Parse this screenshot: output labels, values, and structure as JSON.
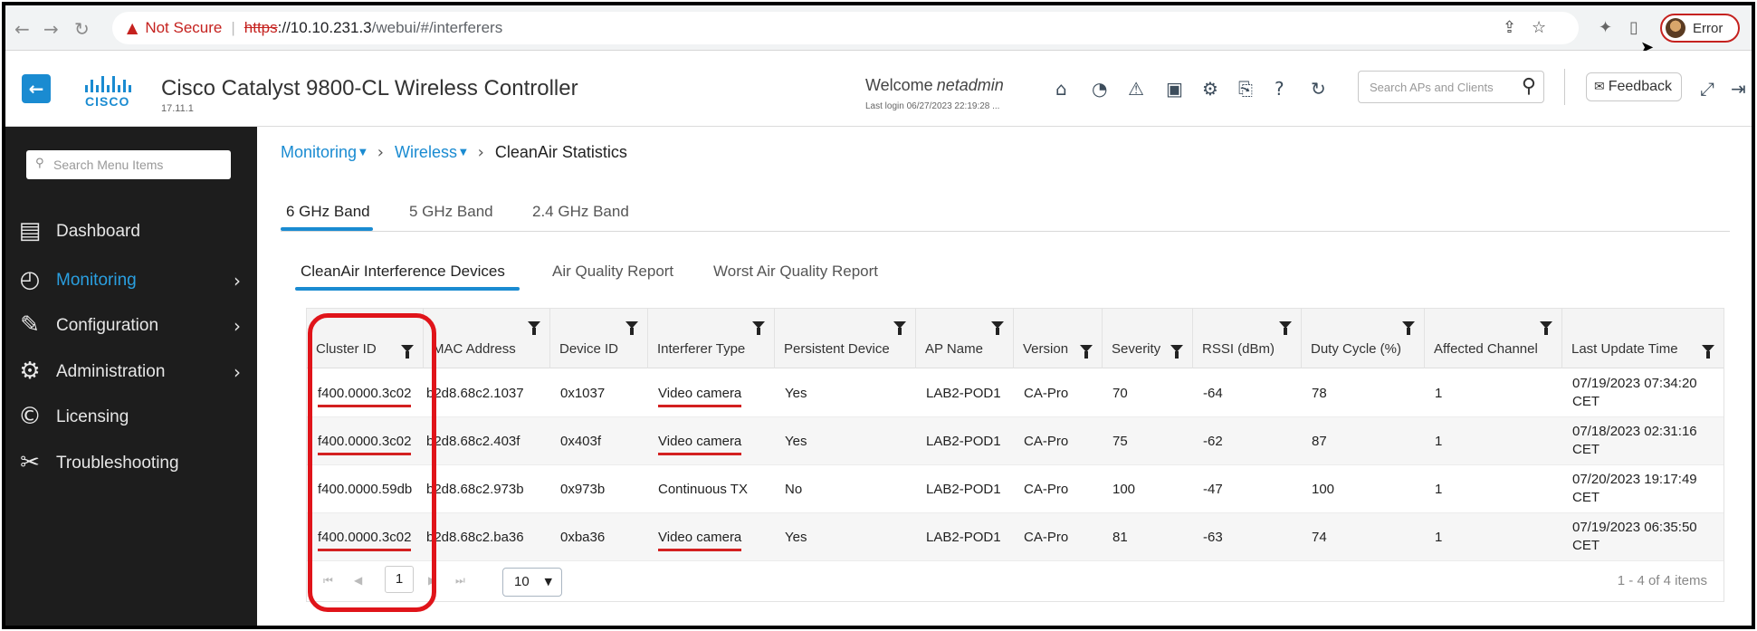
{
  "browser": {
    "security_label": "Not Secure",
    "url_scheme": "https",
    "url_host": "://10.10.231.3",
    "url_path": "/webui/#/interferers",
    "profile_label": "Error"
  },
  "header": {
    "logo_text": "CISCO",
    "title": "Cisco Catalyst 9800-CL Wireless Controller",
    "version": "17.11.1",
    "welcome_prefix": "Welcome",
    "username": "netadmin",
    "last_login": "Last login 06/27/2023 22:19:28 ...",
    "search_placeholder": "Search APs and Clients",
    "feedback_label": "Feedback",
    "icons": [
      "home-icon",
      "wireless-icon",
      "alert-icon",
      "save-icon",
      "gear-icon",
      "config-icon",
      "help-icon",
      "refresh-icon"
    ]
  },
  "sidebar": {
    "search_placeholder": "Search Menu Items",
    "items": [
      {
        "label": "Dashboard",
        "icon": "dashboard-icon",
        "has_children": false,
        "active": false
      },
      {
        "label": "Monitoring",
        "icon": "monitoring-icon",
        "has_children": true,
        "active": true
      },
      {
        "label": "Configuration",
        "icon": "configuration-icon",
        "has_children": true,
        "active": false
      },
      {
        "label": "Administration",
        "icon": "administration-icon",
        "has_children": true,
        "active": false
      },
      {
        "label": "Licensing",
        "icon": "licensing-icon",
        "has_children": false,
        "active": false
      },
      {
        "label": "Troubleshooting",
        "icon": "troubleshooting-icon",
        "has_children": false,
        "active": false
      }
    ]
  },
  "breadcrumb": {
    "monitoring": "Monitoring",
    "wireless": "Wireless",
    "current": "CleanAir Statistics"
  },
  "band_tabs": [
    "6 GHz Band",
    "5 GHz Band",
    "2.4 GHz Band"
  ],
  "sub_tabs": [
    "CleanAir Interference Devices",
    "Air Quality Report",
    "Worst Air Quality Report"
  ],
  "table": {
    "columns": [
      "Cluster ID",
      "MAC Address",
      "Device ID",
      "Interferer Type",
      "Persistent Device",
      "AP Name",
      "Version",
      "Severity",
      "RSSI (dBm)",
      "Duty Cycle (%)",
      "Affected Channel",
      "Last Update Time"
    ],
    "rows": [
      [
        "f400.0000.3c02",
        "b2d8.68c2.1037",
        "0x1037",
        "Video camera",
        "Yes",
        "LAB2-POD1",
        "CA-Pro",
        "70",
        "-64",
        "78",
        "1",
        "07/19/2023 07:34:20 CET"
      ],
      [
        "f400.0000.3c02",
        "b2d8.68c2.403f",
        "0x403f",
        "Video camera",
        "Yes",
        "LAB2-POD1",
        "CA-Pro",
        "75",
        "-62",
        "87",
        "1",
        "07/18/2023 02:31:16 CET"
      ],
      [
        "f400.0000.59db",
        "b2d8.68c2.973b",
        "0x973b",
        "Continuous TX",
        "No",
        "LAB2-POD1",
        "CA-Pro",
        "100",
        "-47",
        "100",
        "1",
        "07/20/2023 19:17:49 CET"
      ],
      [
        "f400.0000.3c02",
        "b2d8.68c2.ba36",
        "0xba36",
        "Video camera",
        "Yes",
        "LAB2-POD1",
        "CA-Pro",
        "81",
        "-63",
        "74",
        "1",
        "07/19/2023 06:35:50 CET"
      ]
    ],
    "underlined_rows": [
      0,
      1,
      3
    ],
    "pager": {
      "current_page": "1",
      "page_size": "10",
      "summary": "1 - 4 of 4 items"
    }
  },
  "colors": {
    "accent": "#1a8bd1",
    "sidebar_bg": "#1d1d1d",
    "annotation_red": "#e0141a"
  }
}
